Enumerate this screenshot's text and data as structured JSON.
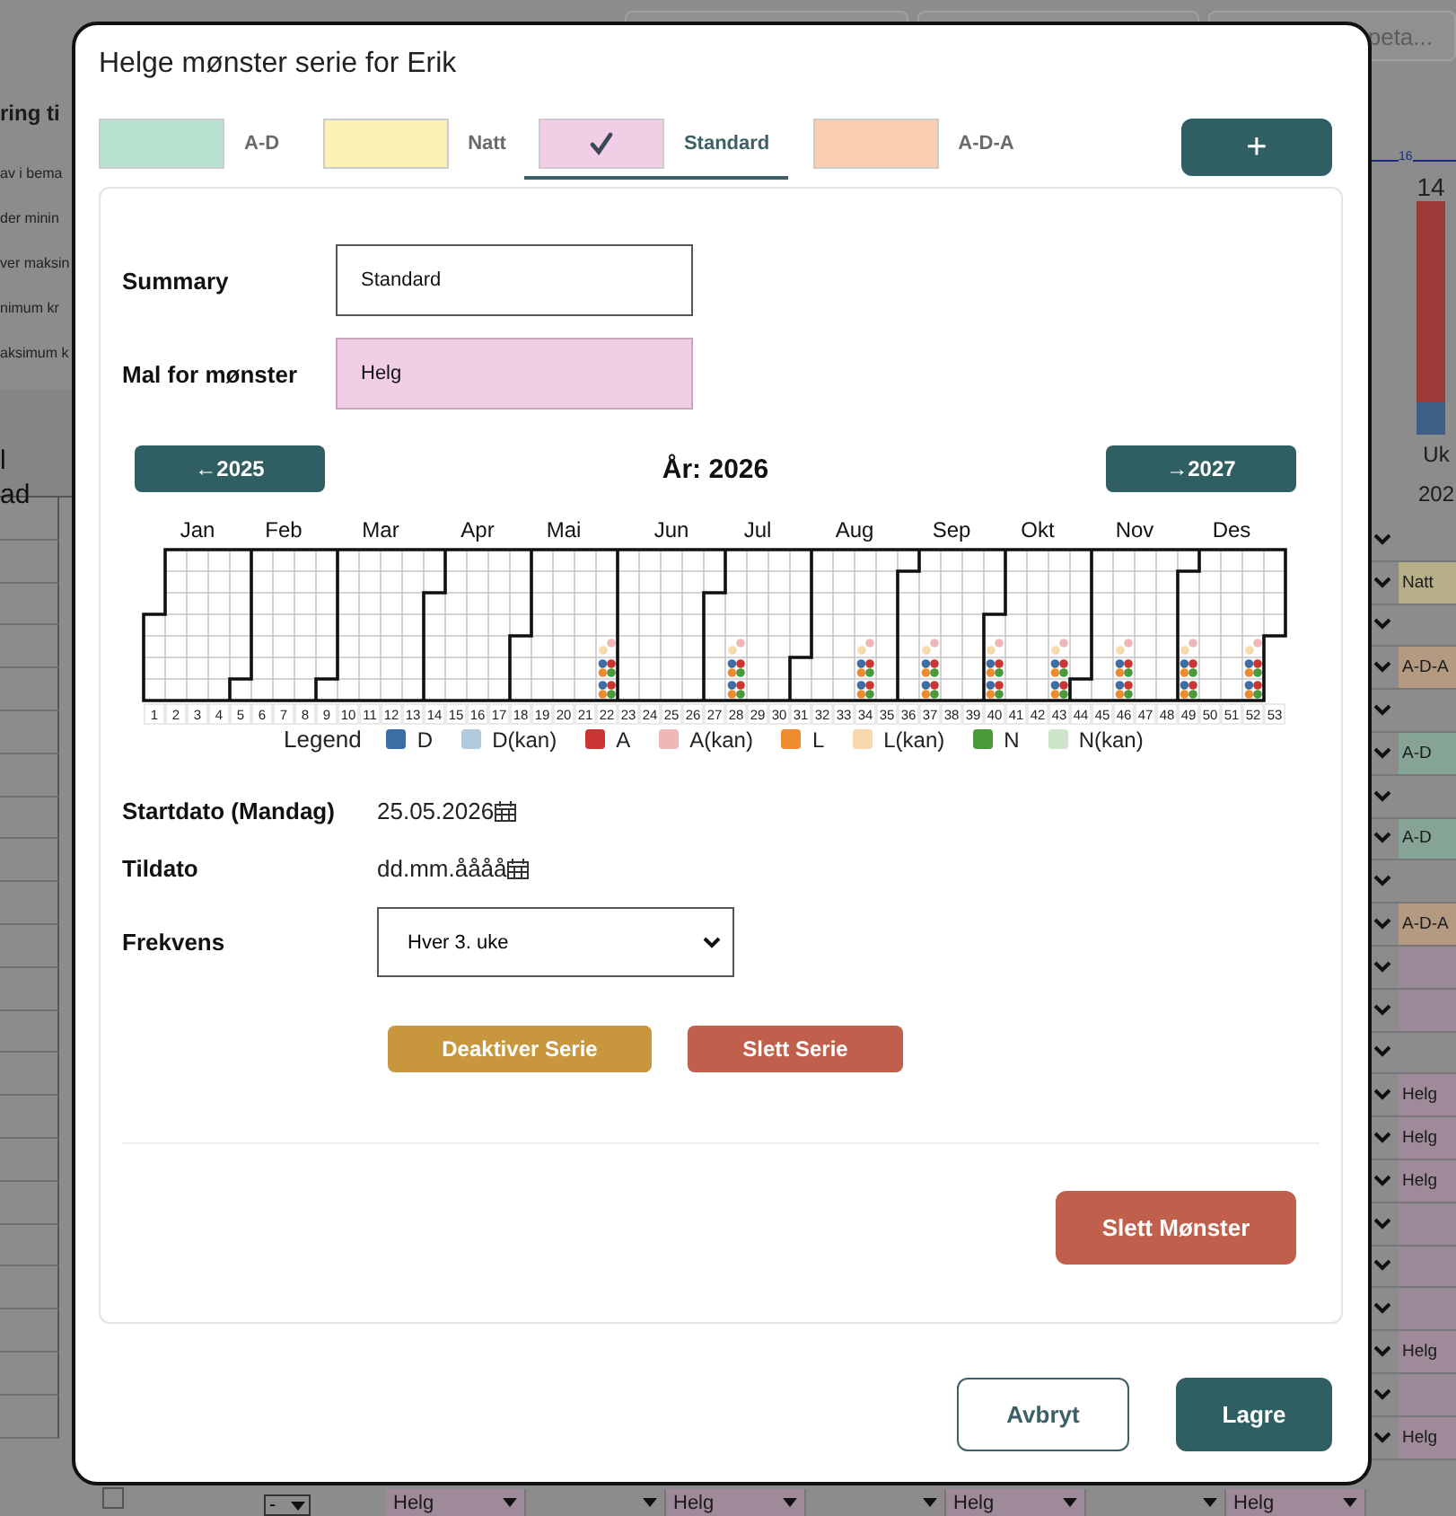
{
  "background": {
    "top_field_placeholder": "peta...",
    "heading": "ring ti",
    "lines": [
      "av i bema",
      "der minin",
      "ver maksin",
      "nimum kr",
      "aksimum k"
    ],
    "column_header": [
      "l",
      "ad"
    ],
    "chart": {
      "marker": "16",
      "value": "14",
      "header": [
        "Uk",
        "202"
      ]
    },
    "rows": [
      {
        "kind": "empty"
      },
      {
        "kind": "shift",
        "label": "Natt",
        "color": "#b5ae86"
      },
      {
        "kind": "empty"
      },
      {
        "kind": "shift",
        "label": "A-D-A",
        "color": "#b59a82"
      },
      {
        "kind": "empty"
      },
      {
        "kind": "shift",
        "label": "A-D",
        "color": "#86a496"
      },
      {
        "kind": "empty"
      },
      {
        "kind": "shift",
        "label": "A-D",
        "color": "#86a496"
      },
      {
        "kind": "empty"
      },
      {
        "kind": "shift",
        "label": "A-D-A",
        "color": "#b59a82"
      },
      {
        "kind": "empty",
        "color": "#9a8a97"
      },
      {
        "kind": "empty",
        "color": "#9a8a97"
      },
      {
        "kind": "empty"
      },
      {
        "kind": "shift",
        "label": "Helg",
        "color": "#9e8a99"
      },
      {
        "kind": "shift",
        "label": "Helg",
        "color": "#9e8a99"
      },
      {
        "kind": "shift",
        "label": "Helg",
        "color": "#9e8a99"
      },
      {
        "kind": "empty",
        "color": "#9a8a97"
      },
      {
        "kind": "empty",
        "color": "#9a8a97"
      },
      {
        "kind": "empty",
        "color": "#9a8a97"
      },
      {
        "kind": "shift",
        "label": "Helg",
        "color": "#9e8a99"
      },
      {
        "kind": "empty",
        "color": "#9a8a97"
      },
      {
        "kind": "shift",
        "label": "Helg",
        "color": "#9e8a99"
      }
    ],
    "bottom_row": {
      "checked": false,
      "first_select": "-",
      "selects": [
        {
          "kind": "shift",
          "value": "Helg"
        },
        {
          "kind": "empty"
        },
        {
          "kind": "shift",
          "value": "Helg"
        },
        {
          "kind": "empty"
        },
        {
          "kind": "shift",
          "value": "Helg"
        },
        {
          "kind": "empty"
        },
        {
          "kind": "shift",
          "value": "Helg"
        }
      ]
    }
  },
  "dialog": {
    "title": "Helge mønster serie for Erik",
    "tabs": [
      {
        "label": "A-D",
        "color": "#b8e2d0",
        "selected": false
      },
      {
        "label": "Natt",
        "color": "#fdf1b4",
        "selected": false
      },
      {
        "label": "Standard",
        "color": "#f2cde6",
        "selected": true
      },
      {
        "label": "A-D-A",
        "color": "#f8cdb0",
        "selected": false
      }
    ],
    "add_button": "+",
    "summary": {
      "label": "Summary",
      "value": "Standard"
    },
    "template": {
      "label": "Mal for mønster",
      "value": "Helg"
    },
    "calendar": {
      "prev": "←2025",
      "year_label": "År:",
      "year": "2026",
      "next": "→2027",
      "months": [
        "Jan",
        "Feb",
        "Mar",
        "Apr",
        "Mai",
        "Jun",
        "Jul",
        "Aug",
        "Sep",
        "Okt",
        "Nov",
        "Des"
      ],
      "weeks": [
        {
          "label": "1",
          "marked": false
        },
        {
          "label": "2",
          "marked": false
        },
        {
          "label": "3",
          "marked": false
        },
        {
          "label": "4",
          "marked": false
        },
        {
          "label": "5",
          "marked": false
        },
        {
          "label": "6",
          "marked": false
        },
        {
          "label": "7",
          "marked": false
        },
        {
          "label": "8",
          "marked": false
        },
        {
          "label": "9",
          "marked": false
        },
        {
          "label": "10",
          "marked": false
        },
        {
          "label": "11",
          "marked": false
        },
        {
          "label": "12",
          "marked": false
        },
        {
          "label": "13",
          "marked": false
        },
        {
          "label": "14",
          "marked": false
        },
        {
          "label": "15",
          "marked": false
        },
        {
          "label": "16",
          "marked": false
        },
        {
          "label": "17",
          "marked": false
        },
        {
          "label": "18",
          "marked": false
        },
        {
          "label": "19",
          "marked": false
        },
        {
          "label": "20",
          "marked": false
        },
        {
          "label": "21",
          "marked": false
        },
        {
          "label": "22",
          "marked": true
        },
        {
          "label": "23",
          "marked": false
        },
        {
          "label": "24",
          "marked": false
        },
        {
          "label": "25",
          "marked": false
        },
        {
          "label": "26",
          "marked": false
        },
        {
          "label": "27",
          "marked": false
        },
        {
          "label": "28",
          "marked": true
        },
        {
          "label": "29",
          "marked": false
        },
        {
          "label": "30",
          "marked": false
        },
        {
          "label": "31",
          "marked": false
        },
        {
          "label": "32",
          "marked": false
        },
        {
          "label": "33",
          "marked": false
        },
        {
          "label": "34",
          "marked": true
        },
        {
          "label": "35",
          "marked": false
        },
        {
          "label": "36",
          "marked": false
        },
        {
          "label": "37",
          "marked": true
        },
        {
          "label": "38",
          "marked": false
        },
        {
          "label": "39",
          "marked": false
        },
        {
          "label": "40",
          "marked": true
        },
        {
          "label": "41",
          "marked": false
        },
        {
          "label": "42",
          "marked": false
        },
        {
          "label": "43",
          "marked": true
        },
        {
          "label": "44",
          "marked": false
        },
        {
          "label": "45",
          "marked": false
        },
        {
          "label": "46",
          "marked": true
        },
        {
          "label": "47",
          "marked": false
        },
        {
          "label": "48",
          "marked": false
        },
        {
          "label": "49",
          "marked": true
        },
        {
          "label": "50",
          "marked": false
        },
        {
          "label": "51",
          "marked": false
        },
        {
          "label": "52",
          "marked": true
        },
        {
          "label": "53",
          "marked": false
        }
      ],
      "legend_title": "Legend",
      "legend": [
        {
          "label": "D",
          "color": "#3a6ea5"
        },
        {
          "label": "D(kan)",
          "color": "#b3c9dd"
        },
        {
          "label": "A",
          "color": "#cc3333"
        },
        {
          "label": "A(kan)",
          "color": "#efb8b8"
        },
        {
          "label": "L",
          "color": "#f08c30"
        },
        {
          "label": "L(kan)",
          "color": "#f7d9ac"
        },
        {
          "label": "N",
          "color": "#4a9a3a"
        },
        {
          "label": "N(kan)",
          "color": "#cfe5cb"
        }
      ]
    },
    "start": {
      "label": "Startdato (Mandag)",
      "value": "25.05.2026"
    },
    "end": {
      "label": "Tildato",
      "placeholder": "dd.mm.åååå"
    },
    "frequency": {
      "label": "Frekvens",
      "value": "Hver 3. uke"
    },
    "deactivate": "Deaktiver Serie",
    "delete_series": "Slett Serie",
    "delete_pattern": "Slett Mønster",
    "cancel": "Avbryt",
    "save": "Lagre"
  }
}
